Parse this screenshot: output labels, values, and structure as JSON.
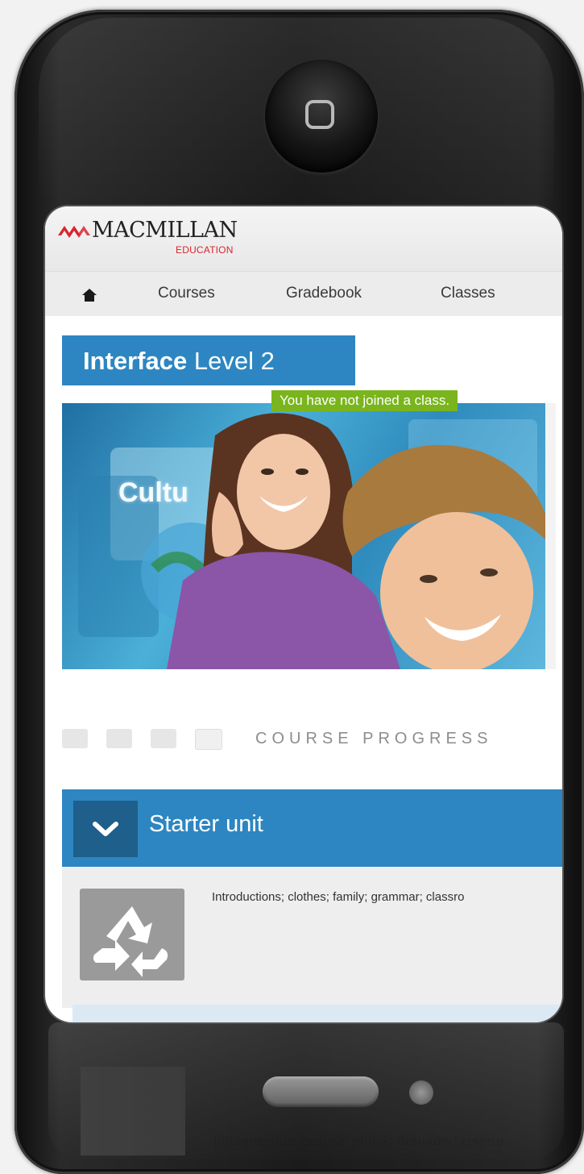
{
  "brand": {
    "name": "MACMILLAN",
    "subline": "EDUCATION",
    "color": "#d8262e"
  },
  "nav": {
    "home_icon": "home-icon",
    "items": [
      "Courses",
      "Gradebook",
      "Classes"
    ]
  },
  "course": {
    "title_bold": "Interface",
    "title_rest": " Level 2",
    "notice": "You have not joined a class.",
    "hero_text": "Cultu",
    "accent": "#2d86c1",
    "notice_color": "#7ab51d"
  },
  "progress": {
    "label": "COURSE PROGRESS",
    "segments_completed": 0,
    "segments_total": 4
  },
  "unit": {
    "title": "Starter unit",
    "toggle_icon": "chevron-down-icon",
    "item_icon": "recycle-icon",
    "description": "Introductions; clothes; family; grammar; classro"
  },
  "reflection": {
    "text": "Introductions; clothes; family; grammar; classro"
  }
}
